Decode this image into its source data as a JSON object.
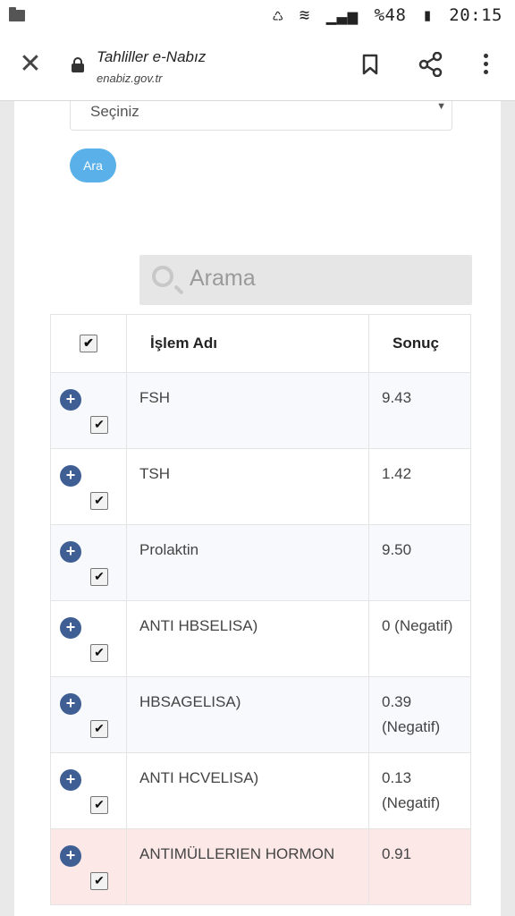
{
  "status_bar": {
    "battery": "%48",
    "time": "20:15"
  },
  "toolbar": {
    "title": "Tahliller e-Nabız",
    "url": "enabiz.gov.tr"
  },
  "form": {
    "select_value": "Seçiniz",
    "search_button": "Ara"
  },
  "search": {
    "placeholder": "Arama"
  },
  "table": {
    "headers": [
      "İşlem Adı",
      "Sonuç"
    ],
    "rows": [
      {
        "name": "FSH",
        "result": "9.43"
      },
      {
        "name": "TSH",
        "result": "1.42"
      },
      {
        "name": "Prolaktin",
        "result": "9.50"
      },
      {
        "name": "ANTI HBSELISA)",
        "result": "0 (Negatif)"
      },
      {
        "name": "HBSAGELISA)",
        "result": "0.39 (Negatif)"
      },
      {
        "name": "ANTI HCVELISA)",
        "result": "0.13 (Negatif)"
      },
      {
        "name": "ANTIMÜLLERIEN HORMON",
        "result": "0.91"
      }
    ]
  },
  "colors": {
    "accent": "#5ab0e8",
    "plus": "#3f5f94",
    "highlight_row": "#fde8e8"
  }
}
